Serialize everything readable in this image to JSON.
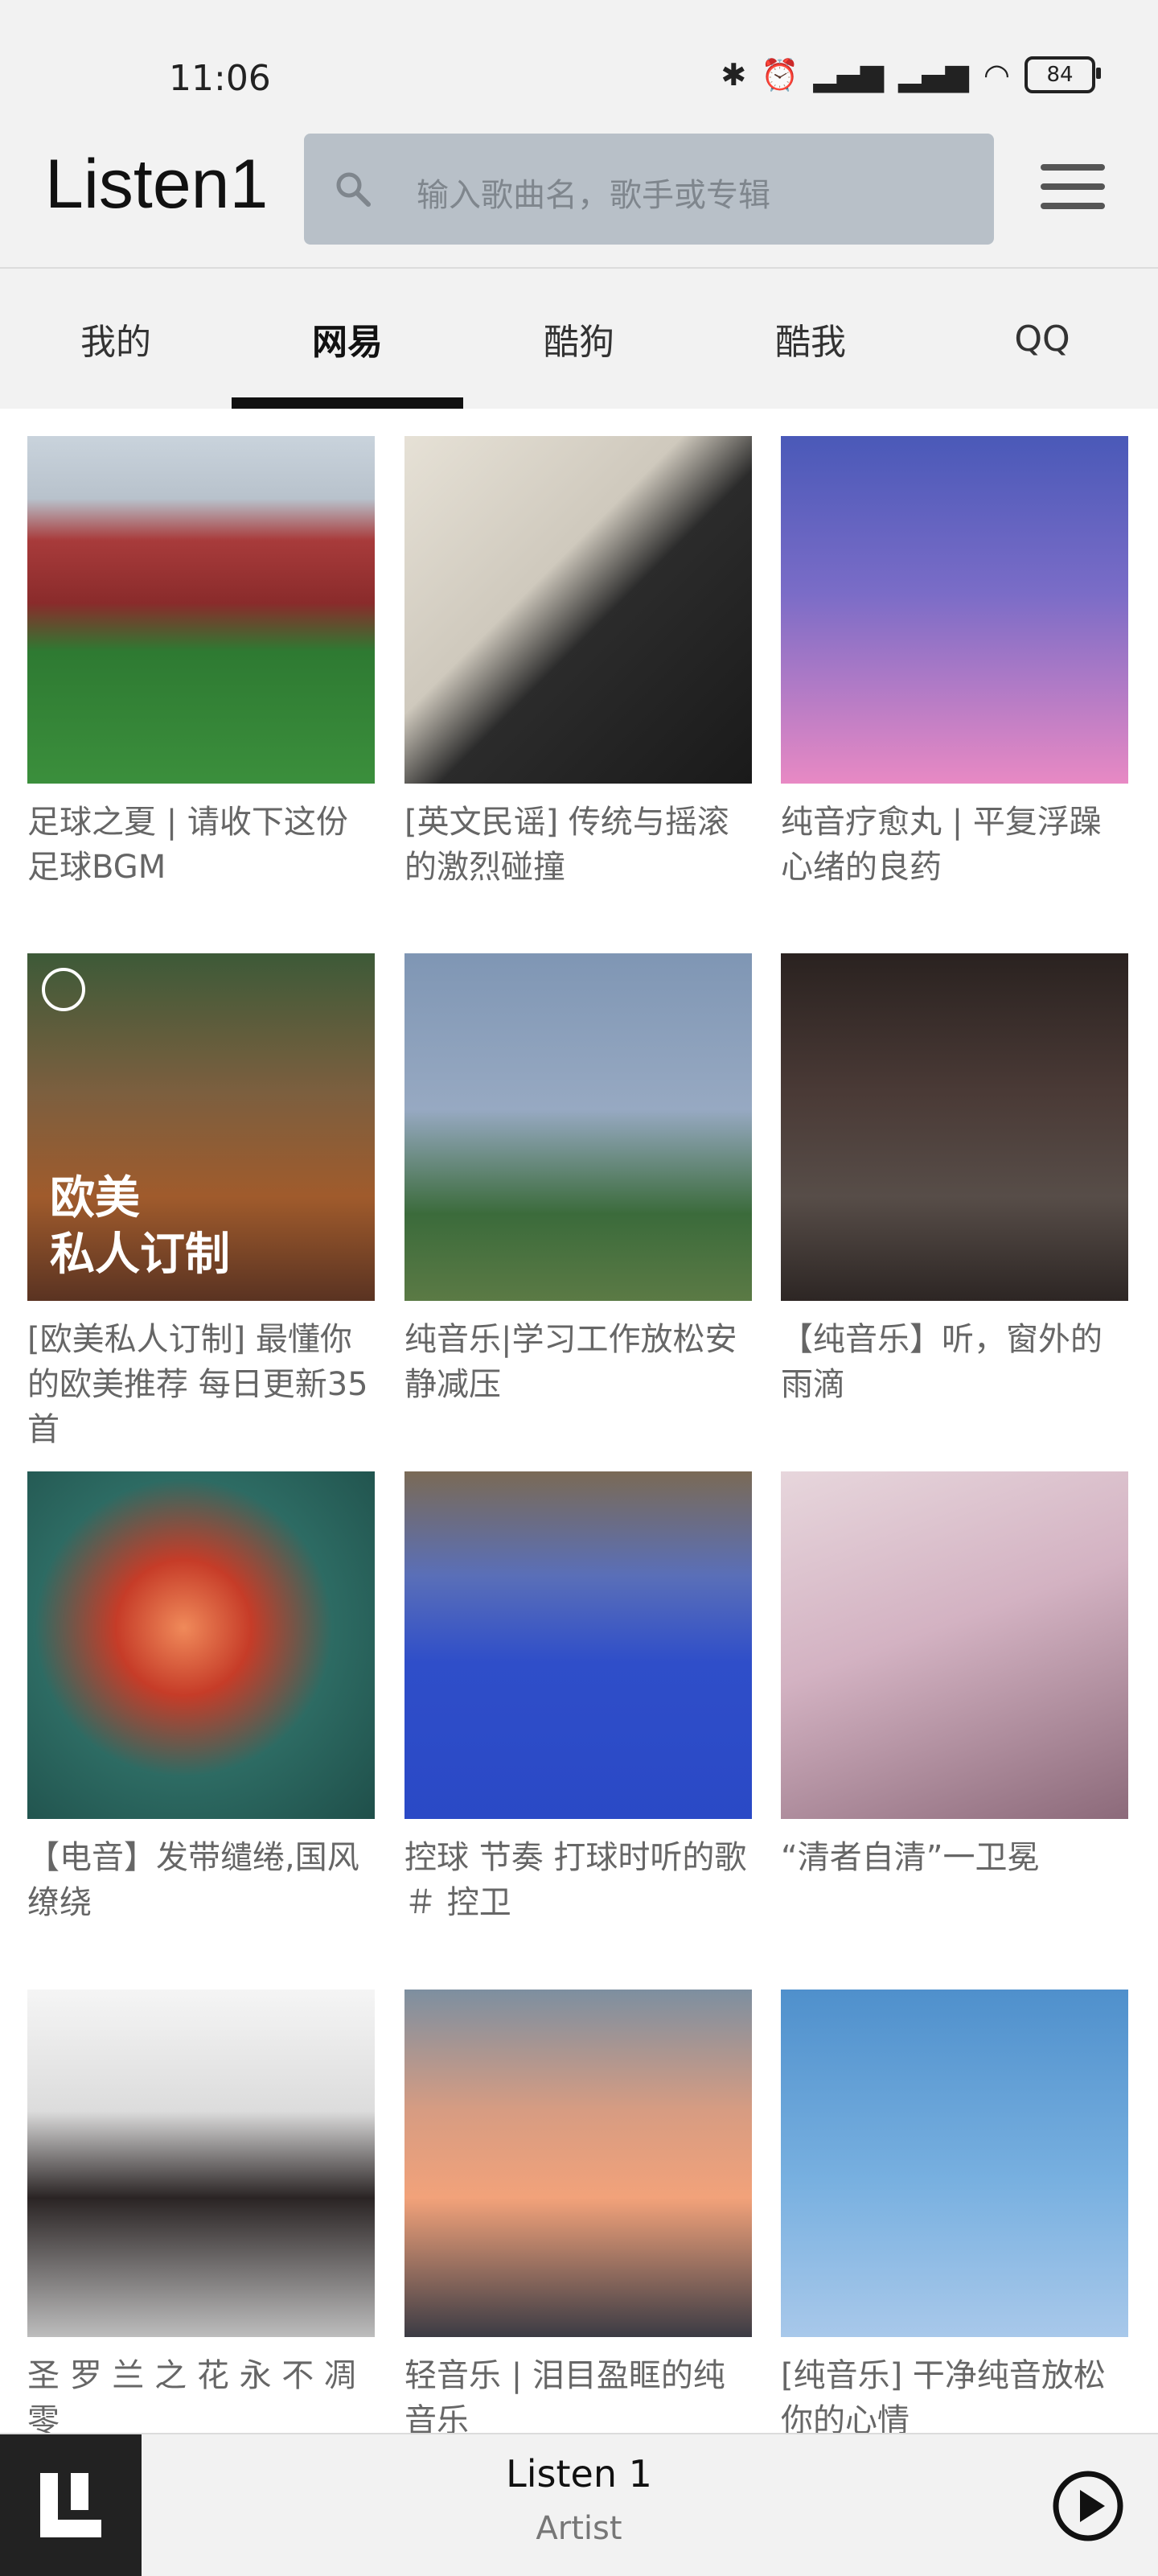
{
  "status_bar": {
    "time": "11:06",
    "battery": "84",
    "icons": [
      "bluetooth-icon",
      "alarm-icon",
      "hd-signal-icon",
      "hd-signal-icon",
      "wifi-icon",
      "battery-icon"
    ]
  },
  "header": {
    "title": "Listen1",
    "search_placeholder": "输入歌曲名，歌手或专辑"
  },
  "tabs": [
    {
      "label": "我的"
    },
    {
      "label": "网易"
    },
    {
      "label": "酷狗"
    },
    {
      "label": "酷我"
    },
    {
      "label": "QQ"
    }
  ],
  "active_tab": "网易",
  "playlists": [
    {
      "title": "足球之夏 | 请收下这份足球BGM"
    },
    {
      "title": "[英文民谣] 传统与摇滚的激烈碰撞"
    },
    {
      "title": "纯音疗愈丸 | 平复浮躁心绪的良药"
    },
    {
      "title": "[欧美私人订制] 最懂你的欧美推荐 每日更新35首",
      "cover_text": "欧美\n私人订制"
    },
    {
      "title": "纯音乐|学习工作放松安静减压"
    },
    {
      "title": "【纯音乐】听，窗外的雨滴"
    },
    {
      "title": "【电音】发带缱绻,国风缭绕"
    },
    {
      "title": "控球 节奏 打球时听的歌 ＃ 控卫"
    },
    {
      "title": "“清者自清”一卫冕"
    },
    {
      "title": "圣 罗 兰 之 花 永 不 凋 零"
    },
    {
      "title": "轻音乐 | 泪目盈眶的纯音乐"
    },
    {
      "title": "[纯音乐] 干净纯音放松你的心情"
    }
  ],
  "player": {
    "song": "Listen 1",
    "artist": "Artist"
  },
  "colors": {
    "background": "#ffffff",
    "bar": "#f2f2f2",
    "search": "#b8c0c8",
    "indicator": "#111111"
  }
}
